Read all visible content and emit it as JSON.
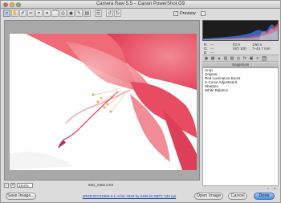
{
  "window": {
    "title": "Camera Raw 5.5  –  Canon PowerShot G9"
  },
  "toolbar": {
    "tools": [
      {
        "name": "zoom-tool",
        "icon": "magnifier-icon",
        "glyph": "⌕"
      },
      {
        "name": "hand-tool",
        "icon": "hand-icon",
        "glyph": "✋"
      },
      {
        "name": "white-balance-tool",
        "icon": "eyedropper-icon",
        "glyph": "✐"
      },
      {
        "name": "color-sampler-tool",
        "icon": "color-sampler-icon",
        "glyph": "✑"
      },
      {
        "name": "targeted-adjustment-tool",
        "icon": "target-icon",
        "glyph": "⌖"
      },
      {
        "name": "crop-tool",
        "icon": "crop-icon",
        "glyph": "⌗"
      },
      {
        "name": "straighten-tool",
        "icon": "straighten-icon",
        "glyph": "⌒"
      },
      {
        "name": "spot-removal-tool",
        "icon": "spot-removal-icon",
        "glyph": "◎"
      },
      {
        "name": "red-eye-tool",
        "icon": "eye-icon",
        "glyph": "◉"
      },
      {
        "name": "adjustment-brush-tool",
        "icon": "brush-icon",
        "glyph": "✎"
      },
      {
        "name": "graduated-filter-tool",
        "icon": "gradient-icon",
        "glyph": "▤"
      },
      {
        "name": "preferences-button",
        "icon": "list-icon",
        "glyph": "☰"
      },
      {
        "name": "rotate-left-button",
        "icon": "rotate-left-icon",
        "glyph": "↺"
      },
      {
        "name": "rotate-right-button",
        "icon": "rotate-right-icon",
        "glyph": "↻"
      }
    ],
    "preview_label": "Preview",
    "preview_checked": true
  },
  "zoom": {
    "value": "19.6%"
  },
  "filename": "IMG_0482.CR2",
  "readout": {
    "r": "R:",
    "g": "G:",
    "b": "B:",
    "r_val": "---",
    "g_val": "---",
    "b_val": "---",
    "aperture": "f/2.8",
    "shutter": "1/60 s",
    "iso": "ISO 100",
    "focal": "7–44.7 mm"
  },
  "panel_tabs": [
    {
      "icon": "aperture-icon",
      "glyph": "◉",
      "active": false
    },
    {
      "icon": "tone-curve-icon",
      "glyph": "▦",
      "active": false
    },
    {
      "icon": "detail-icon",
      "glyph": "▲",
      "active": false
    },
    {
      "icon": "hsl-icon",
      "glyph": "▥",
      "active": false
    },
    {
      "icon": "split-toning-icon",
      "glyph": "▧",
      "active": false
    },
    {
      "icon": "lens-icon",
      "glyph": "◎",
      "active": false
    },
    {
      "icon": "effects-icon",
      "glyph": "fx",
      "active": false
    },
    {
      "icon": "camera-calibration-icon",
      "glyph": "▣",
      "active": false
    },
    {
      "icon": "presets-icon",
      "glyph": "≡",
      "active": false
    },
    {
      "icon": "snapshots-icon",
      "glyph": "▨",
      "active": true
    }
  ],
  "snapshots": {
    "header": "Snapshots",
    "items": [
      "Crop",
      "Original",
      "Red Luminance Boost",
      "S-Curve Adjustment",
      "Sharpen",
      "White Balance"
    ]
  },
  "footer": {
    "save_label": "Save Image...",
    "workflow_text": "sRGB IEC61966-2.1; 8 bit; 3318 by 2488 (8.3MP); 240 ppi",
    "open_label": "Open Image",
    "cancel_label": "Cancel",
    "done_label": "Done"
  },
  "colors": {
    "accent": "#4f8fdf",
    "histogram_bg": "#1d1d1d",
    "petal": "#ea4c64"
  }
}
